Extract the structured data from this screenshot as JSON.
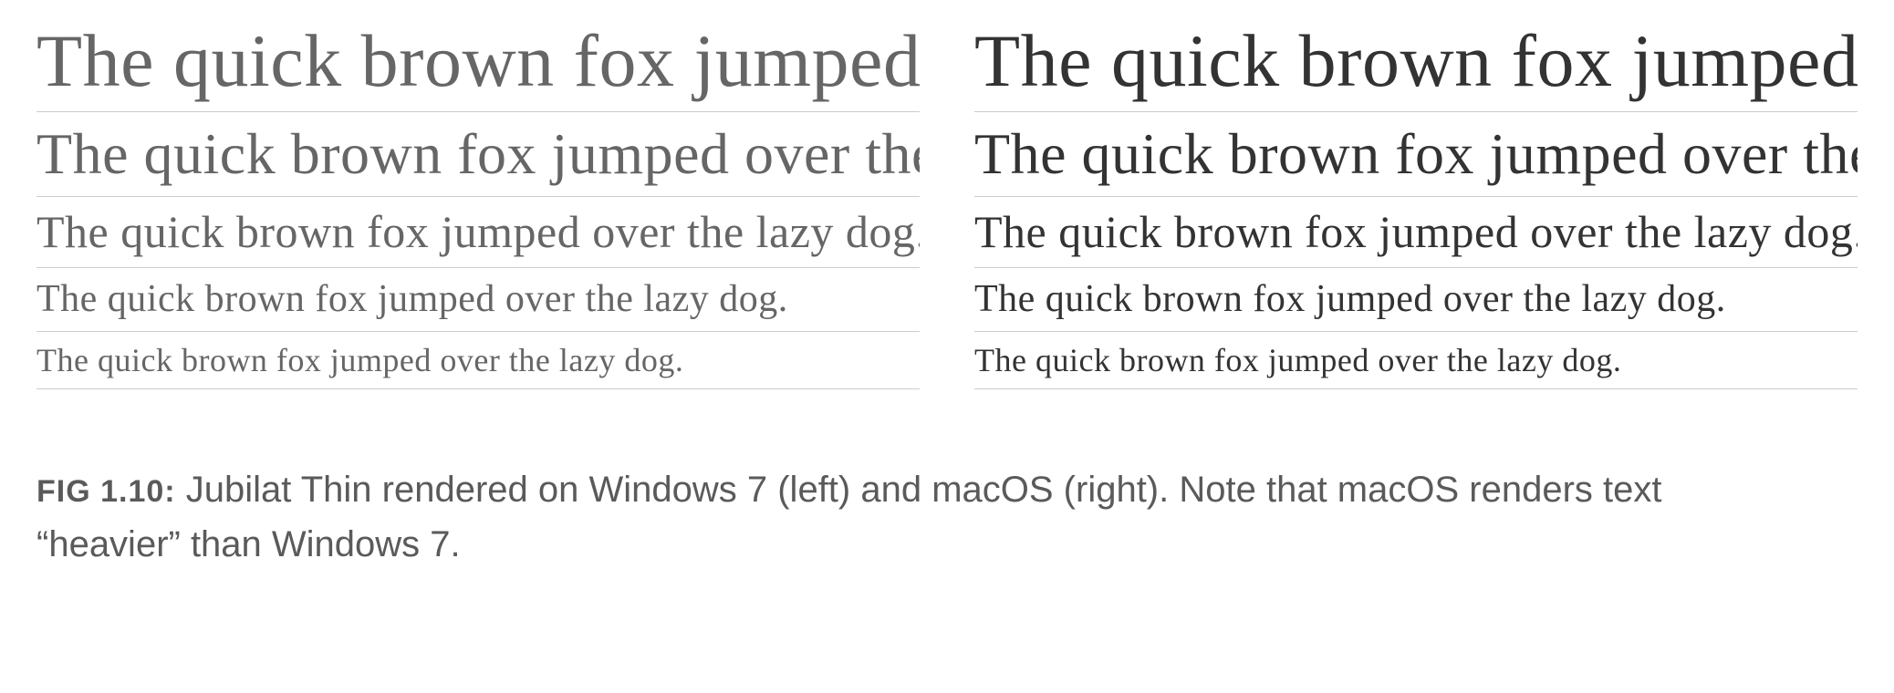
{
  "comparison": {
    "left": {
      "samples": [
        "The quick brown fox jumped over the lazy dog.",
        "The quick brown fox jumped over the lazy dog.",
        "The quick brown fox jumped over the lazy dog.",
        "The quick brown fox jumped over the lazy dog.",
        "The quick brown fox jumped over the lazy dog."
      ]
    },
    "right": {
      "samples": [
        "The quick brown fox jumped over the lazy dog.",
        "The quick brown fox jumped over the lazy dog.",
        "The quick brown fox jumped over the lazy dog.",
        "The quick brown fox jumped over the lazy dog.",
        "The quick brown fox jumped over the lazy dog."
      ]
    }
  },
  "caption": {
    "label": "FIG 1.10:",
    "text": " Jubilat Thin rendered on Windows 7 (left) and macOS (right). Note that macOS renders text “heavier” than Windows 7."
  }
}
